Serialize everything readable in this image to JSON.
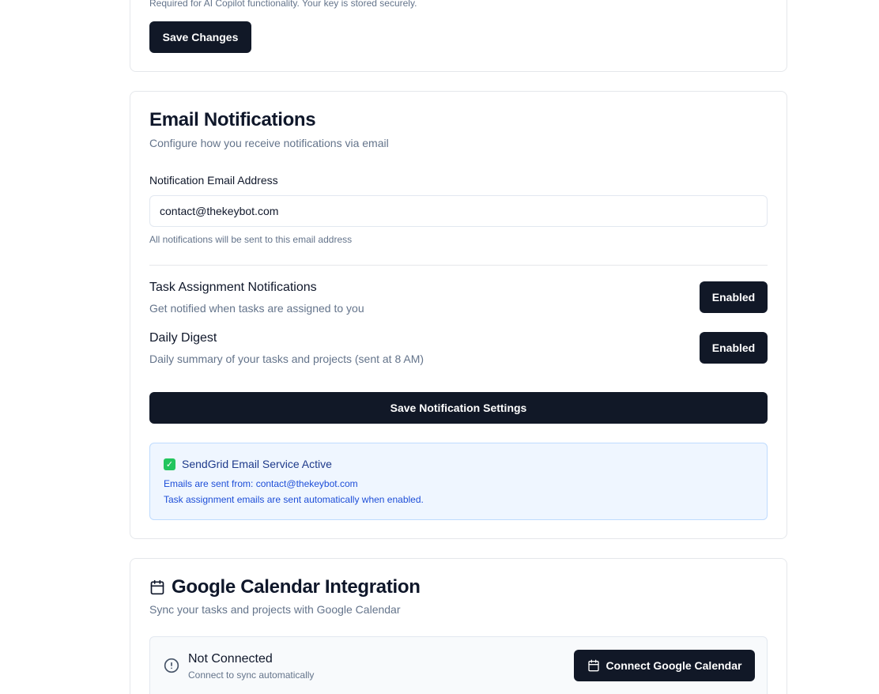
{
  "api_section": {
    "hint": "Required for AI Copilot functionality. Your key is stored securely.",
    "save_label": "Save Changes"
  },
  "email_section": {
    "title": "Email Notifications",
    "subtitle": "Configure how you receive notifications via email",
    "field_label": "Notification Email Address",
    "field_value": "contact@thekeybot.com",
    "field_help": "All notifications will be sent to this email address",
    "preferences": [
      {
        "title": "Task Assignment Notifications",
        "description": "Get notified when tasks are assigned to you",
        "status": "Enabled"
      },
      {
        "title": "Daily Digest",
        "description": "Daily summary of your tasks and projects (sent at 8 AM)",
        "status": "Enabled"
      }
    ],
    "save_label": "Save Notification Settings",
    "service": {
      "title": "SendGrid Email Service Active",
      "from_line": "Emails are sent from: contact@thekeybot.com",
      "note": "Task assignment emails are sent automatically when enabled.",
      "icon": "check-square-icon"
    }
  },
  "calendar_section": {
    "title": "Google Calendar Integration",
    "subtitle": "Sync your tasks and projects with Google Calendar",
    "title_icon": "calendar-icon",
    "status": "Not Connected",
    "status_desc": "Connect to sync automatically",
    "status_icon": "alert-circle-icon",
    "connect_label": "Connect Google Calendar"
  },
  "colors": {
    "primary_button": "#111827",
    "info_bg": "#eff6ff",
    "info_text": "#1d4ed8",
    "success": "#22c55e",
    "muted_text": "#64748b"
  }
}
